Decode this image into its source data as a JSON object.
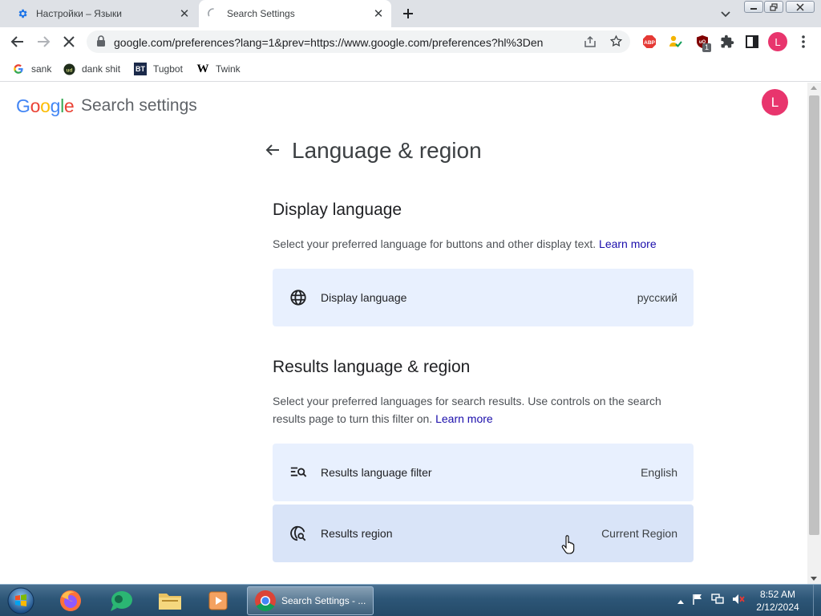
{
  "browser": {
    "tabs": [
      {
        "title": "Настройки – Языки",
        "active": false
      },
      {
        "title": "Search Settings",
        "active": true
      }
    ],
    "url": "google.com/preferences?lang=1&prev=https://www.google.com/preferences?hl%3Den",
    "extensions": {
      "abp_label": "ABP",
      "ublock_badge": "1"
    },
    "profile_initial": "L",
    "bookmarks": [
      {
        "label": "sank",
        "icon": "google-icon"
      },
      {
        "label": "dank shit",
        "icon": "dank-icon"
      },
      {
        "label": "Tugbot",
        "icon": "tugbot-icon",
        "icon_text": "BT"
      },
      {
        "label": "Twink",
        "icon": "wikipedia-icon",
        "icon_text": "W"
      }
    ]
  },
  "page": {
    "logo": "Google",
    "heading_label": "Search settings",
    "avatar_initial": "L",
    "title": "Language & region",
    "display_section": {
      "title": "Display language",
      "description": "Select your preferred language for buttons and other display text.",
      "learn_more": "Learn more",
      "row": {
        "label": "Display language",
        "value": "русский",
        "icon": "globe-icon"
      }
    },
    "results_section": {
      "title": "Results language & region",
      "description": "Select your preferred languages for search results. Use controls on the search results page to turn this filter on.",
      "learn_more": "Learn more",
      "rows": [
        {
          "label": "Results language filter",
          "value": "English",
          "icon": "filter-search-icon"
        },
        {
          "label": "Results region",
          "value": "Current Region",
          "icon": "globe-search-icon"
        }
      ]
    }
  },
  "taskbar": {
    "active_window": "Search Settings - ...",
    "time": "8:52 AM",
    "date": "2/12/2024"
  },
  "colors": {
    "accent_blue": "#1a73e8",
    "avatar_pink": "#e8356d",
    "card_bg": "#e8f0fe",
    "link": "#1a0dab"
  }
}
